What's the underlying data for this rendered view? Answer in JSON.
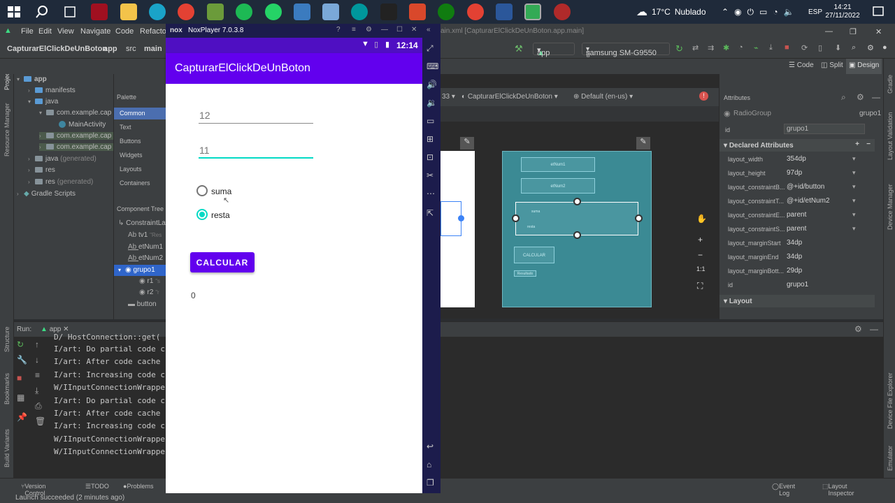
{
  "taskbar": {
    "weather_temp": "17°C",
    "weather_desc": "Nublado",
    "language": "ESP",
    "time": "14:21",
    "date": "27/11/2022"
  },
  "ide": {
    "menu": [
      "File",
      "Edit",
      "View",
      "Navigate",
      "Code",
      "Refactor"
    ],
    "window_title": "ain.xml [CapturarElClickDeUnBoton.app.main]",
    "breadcrumb": [
      "CapturarElClickDeUnBoton",
      "app",
      "src",
      "main"
    ],
    "run_config": "app",
    "device": "samsung SM-G9550",
    "editor_tab": "activity_mai",
    "view_modes": [
      "Code",
      "Split",
      "Design"
    ],
    "design_toolbar": {
      "api": "33",
      "theme": "CapturarElClickDeUnBoton",
      "locale": "Default (en-us)"
    },
    "project_tree": [
      {
        "label": "app",
        "level": 0
      },
      {
        "label": "manifests",
        "level": 1
      },
      {
        "label": "java",
        "level": 1
      },
      {
        "label": "com.example.cap",
        "level": 2
      },
      {
        "label": "MainActivity",
        "level": 3
      },
      {
        "label": "com.example.cap",
        "level": 2
      },
      {
        "label": "com.example.cap",
        "level": 2
      },
      {
        "label": "java",
        "suffix": "(generated)",
        "level": 1
      },
      {
        "label": "res",
        "level": 1
      },
      {
        "label": "res",
        "suffix": "(generated)",
        "level": 1
      },
      {
        "label": "Gradle Scripts",
        "level": 0
      }
    ],
    "palette": {
      "title": "Palette",
      "items": [
        "Common",
        "Text",
        "Buttons",
        "Widgets",
        "Layouts",
        "Containers"
      ]
    },
    "component_tree": {
      "title": "Component Tree",
      "items": [
        {
          "label": "ConstraintLa"
        },
        {
          "label": "tv1",
          "hint": "\"Res"
        },
        {
          "label": "etNum1"
        },
        {
          "label": "etNum2"
        },
        {
          "label": "grupo1"
        },
        {
          "label": "r1",
          "hint": "\"s"
        },
        {
          "label": "r2",
          "hint": "\"r"
        },
        {
          "label": "button"
        }
      ]
    },
    "blueprint": {
      "boxes": [
        "etNum1",
        "etNum2",
        "suma",
        "resta",
        "CALCULAR",
        "Resultado"
      ]
    },
    "attributes": {
      "title": "Attributes",
      "component_type": "RadioGroup",
      "component_id": "grupo1",
      "id_label": "id",
      "id_value": "grupo1",
      "section_declared": "Declared Attributes",
      "rows": [
        {
          "key": "layout_width",
          "value": "354dp"
        },
        {
          "key": "layout_height",
          "value": "97dp"
        },
        {
          "key": "layout_constraintB...",
          "value": "@+id/button"
        },
        {
          "key": "layout_constraintT...",
          "value": "@+id/etNum2"
        },
        {
          "key": "layout_constraintE...",
          "value": "parent"
        },
        {
          "key": "layout_constraintS...",
          "value": "parent"
        },
        {
          "key": "layout_marginStart",
          "value": "34dp"
        },
        {
          "key": "layout_marginEnd",
          "value": "34dp"
        },
        {
          "key": "layout_marginBott...",
          "value": "29dp"
        },
        {
          "key": "id",
          "value": "grupo1"
        }
      ],
      "section_layout": "Layout"
    },
    "side_labels_left": [
      "Project",
      "Resource Manager",
      "Structure",
      "Bookmarks",
      "Build Variants"
    ],
    "side_labels_right": [
      "Gradle",
      "Layout Validation",
      "Device Manager",
      "Device File Explorer",
      "Emulator"
    ],
    "run": {
      "label": "Run:",
      "config": "app",
      "lines": [
        "D/  HostConnection::get(",
        "I/art: Do partial code c",
        "I/art: After code cache",
        "I/art: Increasing code c",
        "W/IInputConnectionWrappe",
        "I/art: Do partial code c",
        "I/art: After code cache",
        "I/art: Increasing code c",
        "W/IInputConnectionWrappe",
        "W/IInputConnectionWrappe"
      ]
    },
    "bottom_tabs": [
      "Version Control",
      "TODO",
      "Problems"
    ],
    "bottom_right_tabs": [
      "Event Log",
      "Layout Inspector"
    ],
    "status_message": "Launch succeeded (2 minutes ago)"
  },
  "emulator": {
    "brand": "nox",
    "title": "NoxPlayer 7.0.3.8",
    "phone_time": "12:14",
    "app_title": "CapturarElClickDeUnBoton",
    "num1": "12",
    "num2": "11",
    "radio_suma": "suma",
    "radio_resta": "resta",
    "selected_radio": "resta",
    "button_label": "CALCULAR",
    "result": "0"
  },
  "colors": {
    "app_bar": "#6200ee",
    "status_bar": "#4f0fc2",
    "accent": "#03dac5",
    "button": "#6200ee",
    "blueprint": "#3b8a94"
  }
}
